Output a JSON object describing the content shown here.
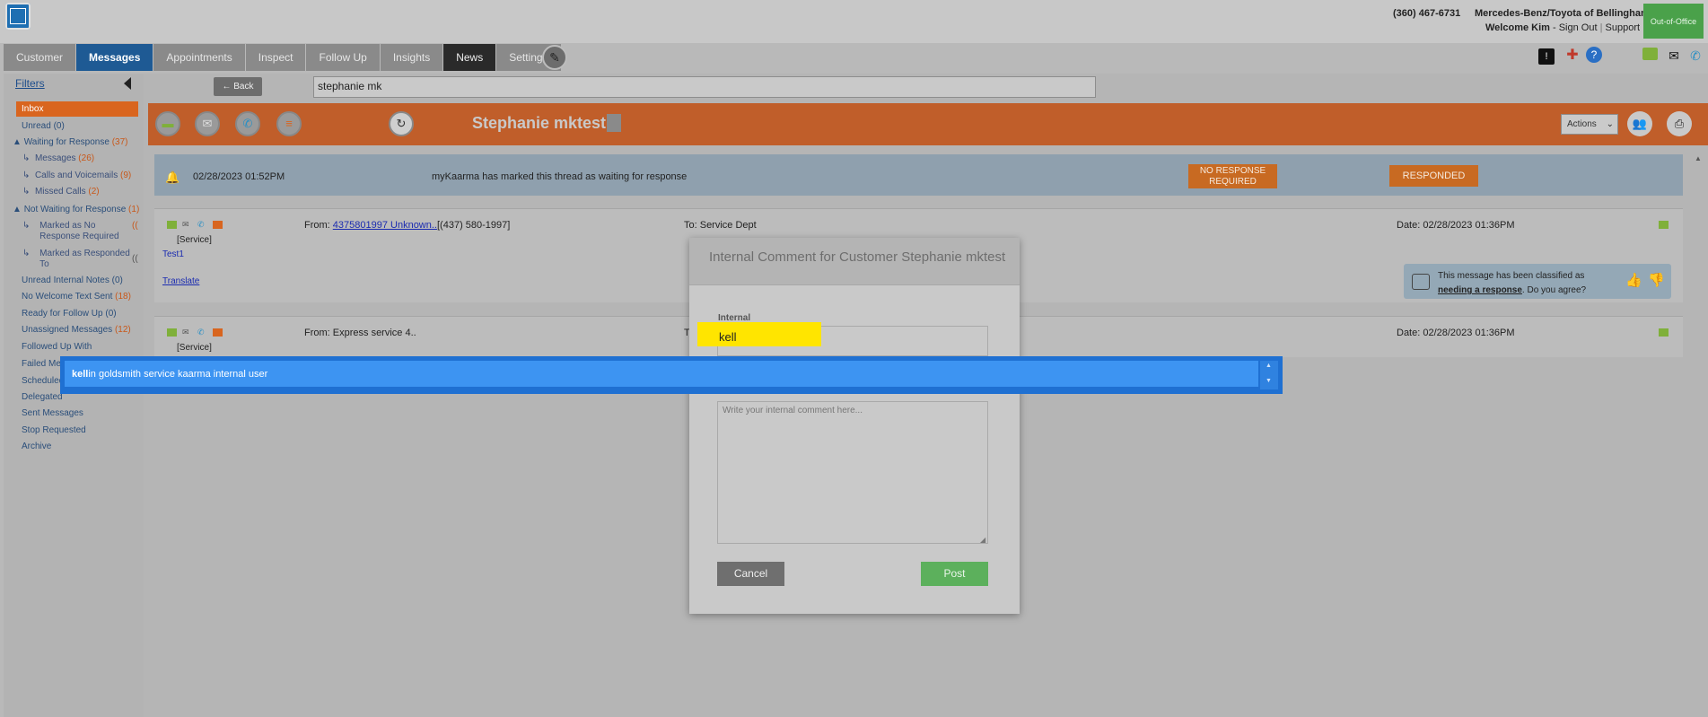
{
  "header": {
    "phone": "(360) 467-6731",
    "dealer": "Mercedes-Benz/Toyota of Bellingham",
    "welcome_prefix": "Welcome Kim",
    "sign_out": "Sign Out",
    "support": "Support",
    "out_of_office": "Out-of-Office"
  },
  "tabs": [
    "Customer",
    "Messages",
    "Appointments",
    "Inspect",
    "Follow Up",
    "Insights",
    "News",
    "Settings"
  ],
  "sidebar": {
    "filters": "Filters",
    "inbox": "Inbox",
    "items": [
      {
        "label": "Unread",
        "count": "(0)"
      },
      {
        "label": "Waiting for Response",
        "count": "(37)"
      },
      {
        "label": "Messages",
        "count": "(26)"
      },
      {
        "label": "Calls and Voicemails",
        "count": "(9)"
      },
      {
        "label": "Missed Calls",
        "count": "(2)"
      },
      {
        "label": "Not Waiting for Response",
        "count": "(1)"
      },
      {
        "label": "Marked as No Response Required",
        "count": "(("
      },
      {
        "label": "Marked as Responded To",
        "count": "(("
      },
      {
        "label": "Unread Internal Notes",
        "count": "(0)"
      },
      {
        "label": "No Welcome Text Sent",
        "count": "(18)"
      },
      {
        "label": "Ready for Follow Up",
        "count": "(0)"
      },
      {
        "label": "Unassigned Messages",
        "count": "(12)"
      },
      {
        "label": "Followed Up With",
        "count": ""
      },
      {
        "label": "Failed Me",
        "count": ""
      },
      {
        "label": "Scheduled",
        "count": ""
      },
      {
        "label": "Delegated",
        "count": ""
      },
      {
        "label": "Sent Messages",
        "count": ""
      },
      {
        "label": "Stop Requested",
        "count": ""
      },
      {
        "label": "Archive",
        "count": ""
      }
    ]
  },
  "search": {
    "back_label": "← Back",
    "value": "stephanie mk"
  },
  "customer": {
    "name": "Stephanie mktest",
    "actions_label": "Actions"
  },
  "notice": {
    "date": "02/28/2023 01:52PM",
    "message": "myKaarma has marked this thread as waiting for response",
    "no_response_label": "NO RESPONSE REQUIRED",
    "responded_label": "RESPONDED"
  },
  "messages": [
    {
      "dept": "[Service]",
      "from_prefix": "From: ",
      "from_link": "4375801997 Unknown..",
      "from_rest": "[(437) 580-1997]",
      "to": "To: Service Dept",
      "date": "Date: 02/28/2023 01:36PM",
      "body": "Test1",
      "translate": "Translate",
      "classified_text": "This message has been classified as",
      "classified_link": "needing a response",
      "classified_q": ". Do you agree?"
    },
    {
      "dept": "[Service]",
      "from": "From: Express service 4..",
      "to_partial": "T",
      "date": "Date: 02/28/2023 01:36PM"
    }
  ],
  "dialog": {
    "title": "Internal Comment for Customer Stephanie mktest",
    "internal_label": "Internal",
    "internal_value": "kell",
    "comment_placeholder": "Write your internal comment here...",
    "cancel_label": "Cancel",
    "post_label": "Post"
  },
  "autocomplete": {
    "match": "kell",
    "rest": "in goldsmith service kaarma internal user"
  },
  "colors": {
    "accent_orange": "#c05e2a",
    "active_tab": "#1e5a94",
    "post_green": "#5cb05c",
    "autocomplete_blue": "#3d94f2",
    "highlight_yellow": "#ffe500"
  }
}
